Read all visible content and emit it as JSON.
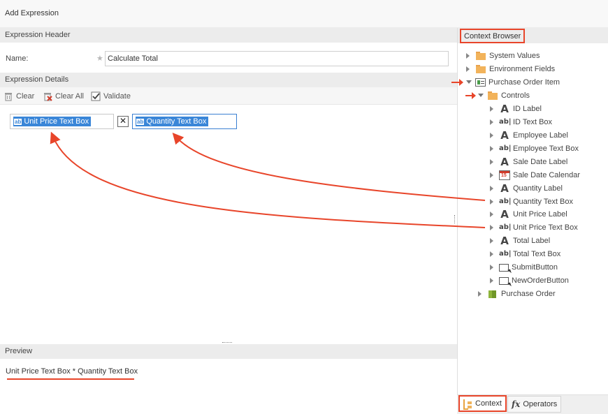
{
  "window": {
    "title": "Add Expression"
  },
  "expression_header": {
    "title": "Expression Header",
    "name_label": "Name:",
    "name_value": "Calculate Total"
  },
  "expression_details": {
    "title": "Expression Details",
    "toolbar": {
      "clear": "Clear",
      "clear_all": "Clear All",
      "validate": "Validate"
    },
    "tokens": [
      {
        "label": "Unit Price Text Box",
        "icon": "ab"
      },
      {
        "label": "Quantity Text Box",
        "icon": "ab"
      }
    ],
    "operator_symbol": "✕"
  },
  "preview": {
    "title": "Preview",
    "text": "Unit Price Text Box * Quantity Text Box"
  },
  "context_browser": {
    "title": "Context Browser",
    "tree": [
      {
        "label": "System Values",
        "icon": "folder-icon"
      },
      {
        "label": "Environment Fields",
        "icon": "folder-icon"
      },
      {
        "label": "Purchase Order Item",
        "icon": "form-icon"
      },
      {
        "label": "Controls",
        "icon": "folder-icon"
      },
      {
        "label": "ID Label",
        "icon": "label-icon"
      },
      {
        "label": "ID Text Box",
        "icon": "textbox-icon"
      },
      {
        "label": "Employee Label",
        "icon": "label-icon"
      },
      {
        "label": "Employee Text Box",
        "icon": "textbox-icon"
      },
      {
        "label": "Sale Date Label",
        "icon": "label-icon"
      },
      {
        "label": "Sale Date Calendar",
        "icon": "calendar-icon"
      },
      {
        "label": "Quantity Label",
        "icon": "label-icon"
      },
      {
        "label": "Quantity Text Box",
        "icon": "textbox-icon"
      },
      {
        "label": "Unit Price Label",
        "icon": "label-icon"
      },
      {
        "label": "Unit Price Text Box",
        "icon": "textbox-icon"
      },
      {
        "label": "Total Label",
        "icon": "label-icon"
      },
      {
        "label": "Total Text Box",
        "icon": "textbox-icon"
      },
      {
        "label": "SubmitButton",
        "icon": "button-icon"
      },
      {
        "label": "NewOrderButton",
        "icon": "button-icon"
      },
      {
        "label": "Purchase Order",
        "icon": "cube-icon"
      }
    ],
    "tabs": {
      "context": "Context",
      "operators": "Operators"
    }
  },
  "colors": {
    "accent": "#3a86d8",
    "highlight": "#e8452a",
    "section_bg": "#ececec"
  }
}
